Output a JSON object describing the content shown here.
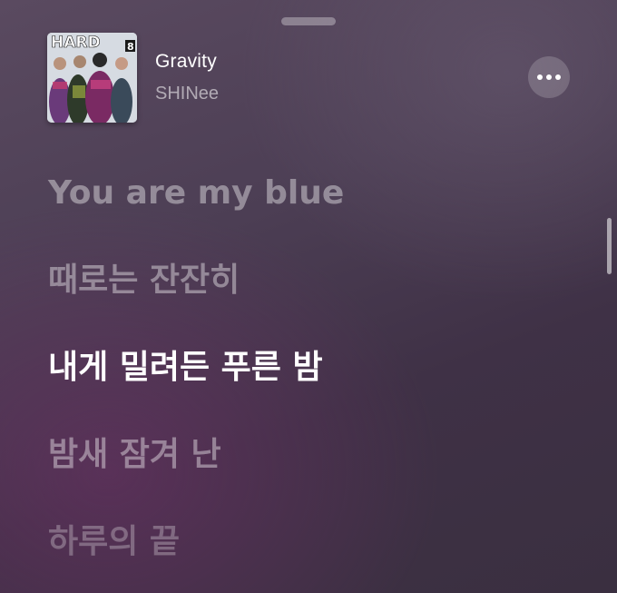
{
  "sheet": {
    "grabber": "drag-handle"
  },
  "now_playing": {
    "album_logo_text": "HARD",
    "album_logo_num": "8",
    "title": "Gravity",
    "artist": "SHINee",
    "more_icon": "ellipsis-icon"
  },
  "lyrics": {
    "lines": [
      "You are my blue",
      "때로는 잔잔히",
      "내게 밀려든 푸른 밤",
      "밤새 잠겨 난",
      "하루의 끝"
    ],
    "active_index": 2
  }
}
